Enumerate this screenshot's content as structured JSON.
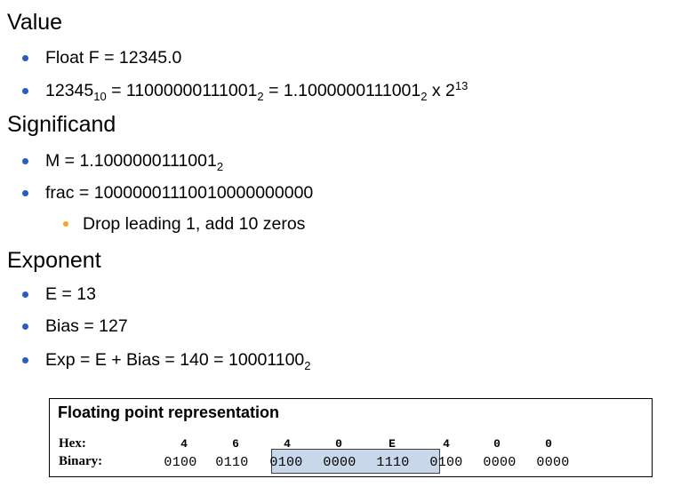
{
  "sections": {
    "value": {
      "heading": "Value",
      "bullet1": "Float F = 12345.0",
      "b2_part1": "12345",
      "b2_sub1": "10",
      "b2_part2": " = 11000000111001",
      "b2_sub2": "2",
      "b2_part3": " = 1.1000000111001",
      "b2_sub3": "2",
      "b2_part4": " x 2",
      "b2_sup": "13"
    },
    "significand": {
      "heading": "Significand",
      "b1_text": "M = 1.1000000111001",
      "b1_sub": "2",
      "bullet2": "frac = 10000001110010000000000",
      "sub_bullet": "Drop leading 1, add 10 zeros"
    },
    "exponent": {
      "heading": "Exponent",
      "bullet1": "E = 13",
      "bullet2": "Bias = 127",
      "b3_text": "Exp = E + Bias = 140 = 10001100",
      "b3_sub": "2"
    }
  },
  "fp_box": {
    "title": "Floating point representation",
    "hex_label": "Hex:",
    "binary_label": "Binary:",
    "hex_digits": [
      "4",
      "6",
      "4",
      "0",
      "E",
      "4",
      "0",
      "0"
    ],
    "binary_nibbles": [
      "0100",
      "0110",
      "0100",
      "0000",
      "1110",
      "0100",
      "0000",
      "0000"
    ],
    "highlight_color": "#c9d7eb"
  },
  "colors": {
    "bullet": "#2e59c8",
    "sub_bullet": "#f5a623"
  }
}
